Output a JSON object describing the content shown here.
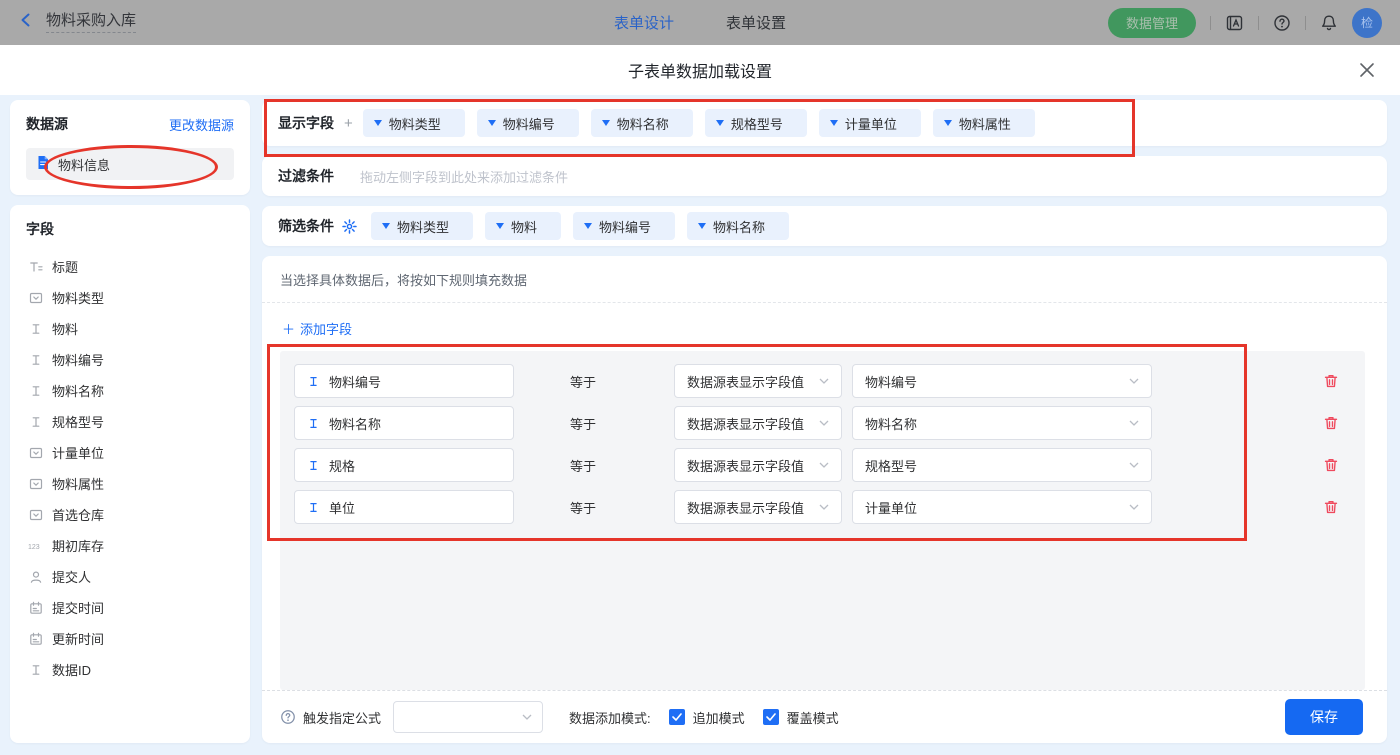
{
  "topbar": {
    "back_title": "物料采购入库",
    "tabs": [
      {
        "label": "表单设计",
        "active": true
      },
      {
        "label": "表单设置",
        "active": false
      }
    ],
    "data_manage_label": "数据管理",
    "avatar_text": "检"
  },
  "modal": {
    "title": "子表单数据加载设置"
  },
  "datasource": {
    "title": "数据源",
    "change_link": "更改数据源",
    "items": [
      {
        "label": "物料信息"
      }
    ]
  },
  "fields_panel": {
    "title": "字段",
    "items": [
      {
        "label": "标题",
        "type": "title"
      },
      {
        "label": "物料类型",
        "type": "select"
      },
      {
        "label": "物料",
        "type": "input"
      },
      {
        "label": "物料编号",
        "type": "input"
      },
      {
        "label": "物料名称",
        "type": "input"
      },
      {
        "label": "规格型号",
        "type": "input"
      },
      {
        "label": "计量单位",
        "type": "select"
      },
      {
        "label": "物料属性",
        "type": "select"
      },
      {
        "label": "首选仓库",
        "type": "select"
      },
      {
        "label": "期初库存",
        "type": "number"
      },
      {
        "label": "提交人",
        "type": "user"
      },
      {
        "label": "提交时间",
        "type": "date"
      },
      {
        "label": "更新时间",
        "type": "date"
      },
      {
        "label": "数据ID",
        "type": "input"
      }
    ]
  },
  "display_fields": {
    "label": "显示字段",
    "add": "+",
    "tags": [
      "物料类型",
      "物料编号",
      "物料名称",
      "规格型号",
      "计量单位",
      "物料属性"
    ]
  },
  "filter": {
    "label": "过滤条件",
    "placeholder": "拖动左侧字段到此处来添加过滤条件"
  },
  "screen": {
    "label": "筛选条件",
    "tags": [
      "物料类型",
      "物料",
      "物料编号",
      "物料名称"
    ]
  },
  "rules": {
    "header": "当选择具体数据后，将按如下规则填充数据",
    "add_field": "添加字段",
    "equals": "等于",
    "rows": [
      {
        "field": "物料编号",
        "source": "数据源表显示字段值",
        "value": "物料编号"
      },
      {
        "field": "物料名称",
        "source": "数据源表显示字段值",
        "value": "物料名称"
      },
      {
        "field": "规格",
        "source": "数据源表显示字段值",
        "value": "规格型号"
      },
      {
        "field": "单位",
        "source": "数据源表显示字段值",
        "value": "计量单位"
      }
    ]
  },
  "footer": {
    "formula_label": "触发指定公式",
    "mode_label": "数据添加模式:",
    "checkboxes": [
      {
        "label": "追加模式",
        "checked": true
      },
      {
        "label": "覆盖模式",
        "checked": true
      }
    ],
    "save": "保存"
  },
  "colors": {
    "accent_blue": "#1f6ef5",
    "annotation_red": "#e5352a",
    "data_manage_green": "#41975e",
    "trash_red": "#ef4a5e",
    "modal_background": "#e9f2fc"
  }
}
